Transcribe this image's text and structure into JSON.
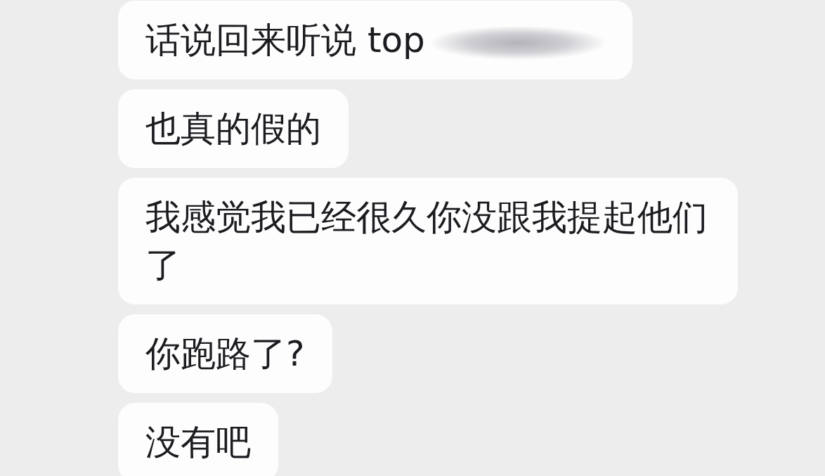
{
  "messages": [
    {
      "text": "话说回来听说 top",
      "redacted": true
    },
    {
      "text": "也真的假的",
      "redacted": false
    },
    {
      "text": "我感觉我已经很久你没跟我提起他们了",
      "redacted": false
    },
    {
      "text": "你跑路了?",
      "redacted": false
    },
    {
      "text": "没有吧",
      "redacted": false
    }
  ]
}
